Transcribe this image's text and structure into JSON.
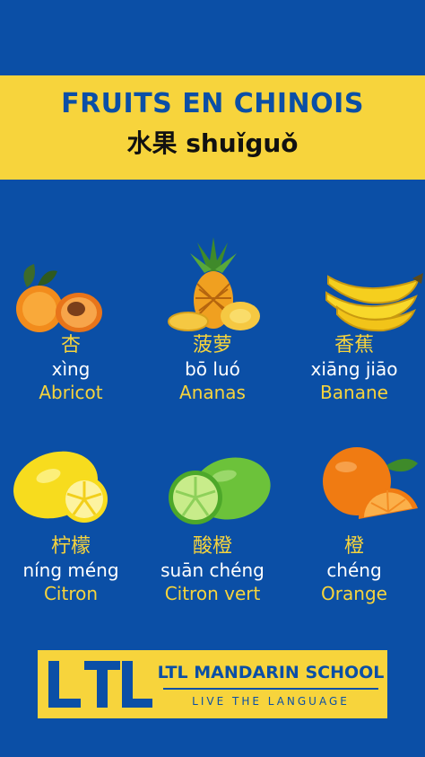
{
  "header": {
    "title": "FRUITS EN CHINOIS",
    "subtitle": "水果 shuǐguǒ"
  },
  "fruits": [
    {
      "icon": "apricot-icon",
      "hanzi": "杏",
      "pinyin": "xìng",
      "french": "Abricot"
    },
    {
      "icon": "pineapple-icon",
      "hanzi": "菠萝",
      "pinyin": "bō luó",
      "french": "Ananas"
    },
    {
      "icon": "banana-icon",
      "hanzi": "香蕉",
      "pinyin": "xiāng jiāo",
      "french": "Banane"
    },
    {
      "icon": "lemon-icon",
      "hanzi": "柠檬",
      "pinyin": "níng méng",
      "french": "Citron"
    },
    {
      "icon": "lime-icon",
      "hanzi": "酸橙",
      "pinyin": "suān chéng",
      "french": "Citron vert"
    },
    {
      "icon": "orange-icon",
      "hanzi": "橙",
      "pinyin": "chéng",
      "french": "Orange"
    }
  ],
  "logo": {
    "name": "LTL MANDARIN SCHOOL",
    "tagline": "LIVE THE LANGUAGE"
  },
  "colors": {
    "background": "#0b4fa6",
    "accent": "#f7d43c",
    "text": "#ffffff"
  }
}
